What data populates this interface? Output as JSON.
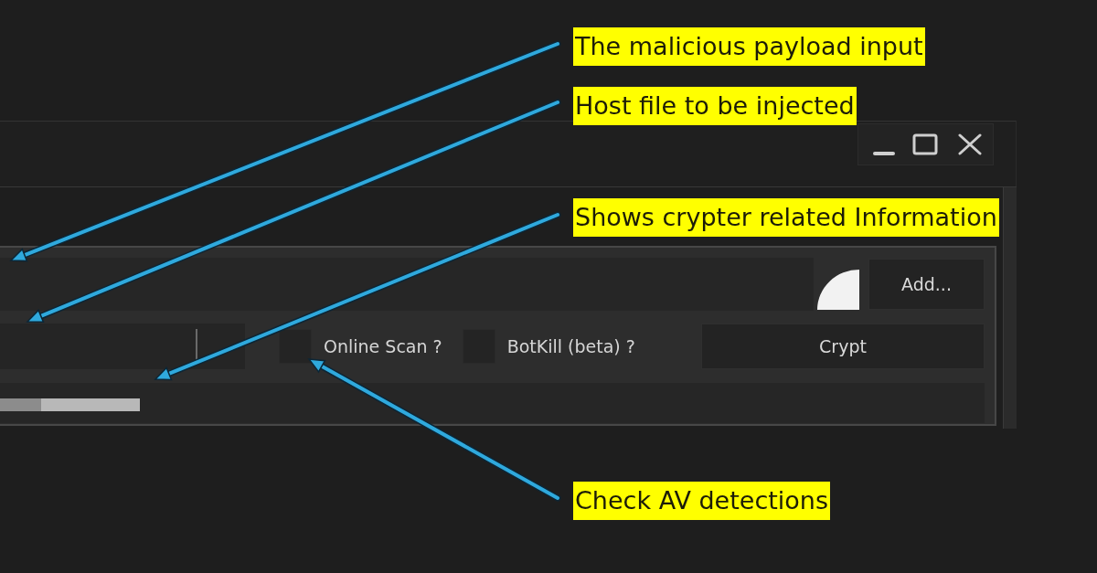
{
  "payload_row": {
    "button": "Add..."
  },
  "host_row": {
    "options": [
      {
        "label": "Online Scan ?",
        "checked": false
      },
      {
        "label": "BotKill (beta) ?",
        "checked": false
      }
    ],
    "button": "Crypt"
  },
  "annotations": [
    {
      "text": "The malicious payload input"
    },
    {
      "text": "Host file to be injected"
    },
    {
      "text": "Shows crypter related Information"
    },
    {
      "text": "Check AV detections"
    }
  ]
}
